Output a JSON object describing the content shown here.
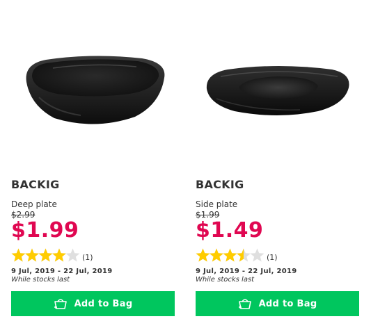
{
  "products": [
    {
      "name": "BACKIG",
      "description": "Deep plate",
      "old_price": "$2.99",
      "price": "$1.99",
      "rating": 4,
      "rating_max": 5,
      "review_count": "(1)",
      "dates": "9 Jul, 2019 - 22 Jul, 2019",
      "stock_note": "While stocks last",
      "button_label": "Add to Bag",
      "image_icon": "deep-plate-image"
    },
    {
      "name": "BACKIG",
      "description": "Side plate",
      "old_price": "$1.99",
      "price": "$1.49",
      "rating": 3.5,
      "rating_max": 5,
      "review_count": "(1)",
      "dates": "9 Jul, 2019 - 22 Jul, 2019",
      "stock_note": "While stocks last",
      "button_label": "Add to Bag",
      "image_icon": "side-plate-image"
    }
  ],
  "colors": {
    "price": "#e00751",
    "button": "#00c65e",
    "star_filled": "#ffcc00",
    "star_empty": "#dfdfdf"
  }
}
